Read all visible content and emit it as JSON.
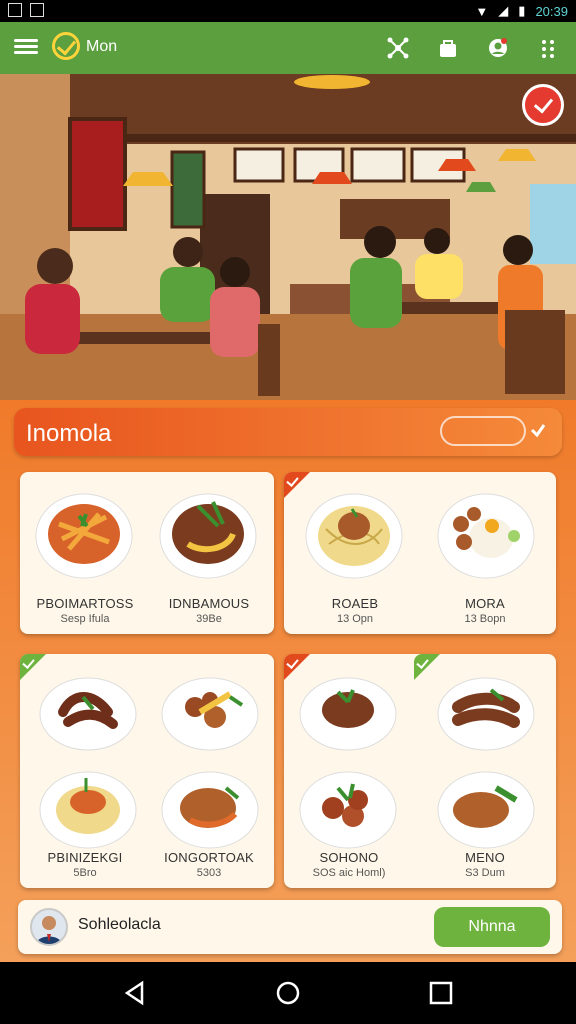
{
  "status": {
    "time": "20:39"
  },
  "appbar": {
    "title": "Mon"
  },
  "category": {
    "title": "Inomola"
  },
  "cards": [
    {
      "items": [
        {
          "name": "PBOIMARTOSS",
          "sub": "Sesp Ifula"
        },
        {
          "name": "IDNBAMOUS",
          "sub": "39Be"
        }
      ]
    },
    {
      "items": [
        {
          "name": "ROAEB",
          "sub": "13 Opn"
        },
        {
          "name": "MORA",
          "sub": "13 Bopn"
        }
      ]
    },
    {
      "items": [
        {
          "name": "PBINIZEKGI",
          "sub": "5Bro"
        },
        {
          "name": "IONGORTOAK",
          "sub": "5303"
        }
      ]
    },
    {
      "items": [
        {
          "name": "SOHONO",
          "sub": "SOS aic Homl)"
        },
        {
          "name": "MENO",
          "sub": "S3 Dum"
        }
      ]
    }
  ],
  "footer": {
    "username": "Sohleolacla",
    "menu_button": "Nhnna"
  },
  "colors": {
    "appbar": "#5b9f3e",
    "accent": "#f07a2a",
    "menu_button": "#6fb33f",
    "check_red": "#e53a2f"
  },
  "icons": [
    "menu-icon",
    "logo-check-icon",
    "share-icon",
    "bag-icon",
    "profile-icon",
    "more-vert-icon",
    "back-icon",
    "home-icon",
    "recents-icon"
  ]
}
